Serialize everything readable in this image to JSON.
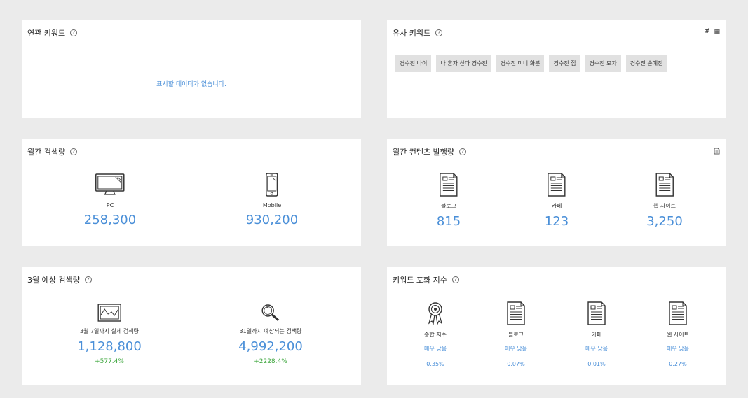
{
  "related": {
    "title": "연관 키워드",
    "empty_text": "표시할 데이터가 없습니다."
  },
  "similar": {
    "title": "유사 키워드",
    "tools": [
      "#",
      "▦"
    ],
    "tags": [
      "경수진 나이",
      "나 혼자 산다 경수진",
      "경수진 미니 화분",
      "경수진 집",
      "경수진 모자",
      "경수진 손예진"
    ]
  },
  "monthly_search": {
    "title": "월간 검색량",
    "items": [
      {
        "icon": "monitor-icon",
        "label": "PC",
        "value": "258,300"
      },
      {
        "icon": "mobile-icon",
        "label": "Mobile",
        "value": "930,200"
      }
    ]
  },
  "monthly_content": {
    "title": "월간 컨텐츠 발행량",
    "items": [
      {
        "icon": "document-icon",
        "label": "블로그",
        "value": "815"
      },
      {
        "icon": "document-icon",
        "label": "카페",
        "value": "123"
      },
      {
        "icon": "document-icon",
        "label": "웹 사이트",
        "value": "3,250"
      }
    ]
  },
  "forecast": {
    "title": "3월 예상 검색량",
    "items": [
      {
        "icon": "chart-frame-icon",
        "label": "3월 7일까지 실제 검색량",
        "value": "1,128,800",
        "change": "+577.4%"
      },
      {
        "icon": "magnifier-icon",
        "label": "31일까지 예상되는 검색량",
        "value": "4,992,200",
        "change": "+2228.4%"
      }
    ]
  },
  "saturation": {
    "title": "키워드 포화 지수",
    "items": [
      {
        "icon": "award-ribbon-icon",
        "label": "종합 지수",
        "level": "매우 낮음",
        "percent": "0.35%"
      },
      {
        "icon": "document-icon",
        "label": "블로그",
        "level": "매우 낮음",
        "percent": "0.07%"
      },
      {
        "icon": "document-icon",
        "label": "카페",
        "level": "매우 낮음",
        "percent": "0.01%"
      },
      {
        "icon": "document-icon",
        "label": "웹 사이트",
        "level": "매우 낮음",
        "percent": "0.27%"
      }
    ]
  },
  "colors": {
    "background": "#ebebeb",
    "panel": "#ffffff",
    "accent": "#4a8fd8",
    "positive": "#3aa53a",
    "tag": "#e1e1e1"
  }
}
